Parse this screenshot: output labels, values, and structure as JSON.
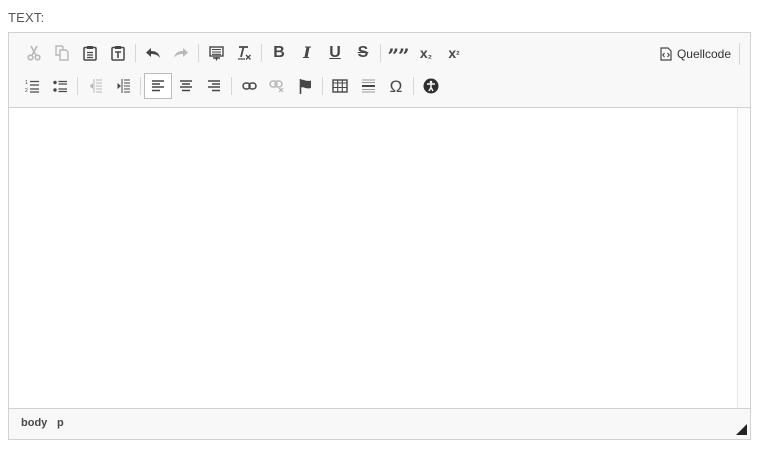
{
  "field": {
    "label": "TEXT:"
  },
  "toolbar": {
    "row1": [
      {
        "name": "cut-button",
        "icon": "scissors-icon",
        "state": "disabled"
      },
      {
        "name": "copy-button",
        "icon": "copy-icon",
        "state": "disabled"
      },
      {
        "name": "paste-button",
        "icon": "clipboard-icon",
        "state": "enabled"
      },
      {
        "name": "paste-text-button",
        "icon": "paste-text-icon",
        "state": "enabled"
      },
      {
        "name": "undo-button",
        "icon": "undo-icon",
        "state": "enabled"
      },
      {
        "name": "redo-button",
        "icon": "redo-icon",
        "state": "disabled"
      },
      {
        "name": "format-block-button",
        "icon": "format-icon",
        "state": "enabled"
      },
      {
        "name": "remove-format-button",
        "icon": "remove-format-icon",
        "state": "enabled"
      },
      {
        "name": "bold-button",
        "glyph": "B"
      },
      {
        "name": "italic-button",
        "glyph": "I"
      },
      {
        "name": "underline-button",
        "glyph": "U"
      },
      {
        "name": "strikethrough-button",
        "glyph": "S"
      },
      {
        "name": "blockquote-button",
        "glyph": "””"
      },
      {
        "name": "subscript-button",
        "glyph": "x₂"
      },
      {
        "name": "superscript-button",
        "glyph": "x²"
      }
    ],
    "row2": [
      {
        "name": "numbered-list-button",
        "icon": "numbered-list-icon"
      },
      {
        "name": "bulleted-list-button",
        "icon": "bulleted-list-icon"
      },
      {
        "name": "outdent-button",
        "icon": "outdent-icon",
        "state": "disabled"
      },
      {
        "name": "indent-button",
        "icon": "indent-icon"
      },
      {
        "name": "align-left-button",
        "icon": "align-left-icon",
        "state": "active"
      },
      {
        "name": "align-center-button",
        "icon": "align-center-icon"
      },
      {
        "name": "align-right-button",
        "icon": "align-right-icon"
      },
      {
        "name": "link-button",
        "icon": "link-icon"
      },
      {
        "name": "unlink-button",
        "icon": "unlink-icon",
        "state": "disabled"
      },
      {
        "name": "anchor-button",
        "icon": "flag-icon"
      },
      {
        "name": "table-button",
        "icon": "table-icon"
      },
      {
        "name": "horizontal-rule-button",
        "icon": "horizontal-rule-icon"
      },
      {
        "name": "special-char-button",
        "glyph": "Ω"
      },
      {
        "name": "accessibility-button",
        "icon": "accessibility-icon"
      }
    ],
    "source": {
      "label": "Quellcode",
      "icon": "source-code-icon"
    }
  },
  "glyphs": {
    "bold": "B",
    "italic": "I",
    "underline": "U",
    "strike": "S",
    "quote": "””",
    "sub_x": "x",
    "sub_n": "₂",
    "sup_x": "x",
    "sup_n": "²",
    "omega": "Ω"
  },
  "statusbar": {
    "path": [
      "body",
      "p"
    ]
  },
  "colors": {
    "icon": "#474747",
    "icon_disabled": "#b8b8b8",
    "toolbar_bg": "#f8f8f8",
    "border": "#d1d1d1"
  }
}
